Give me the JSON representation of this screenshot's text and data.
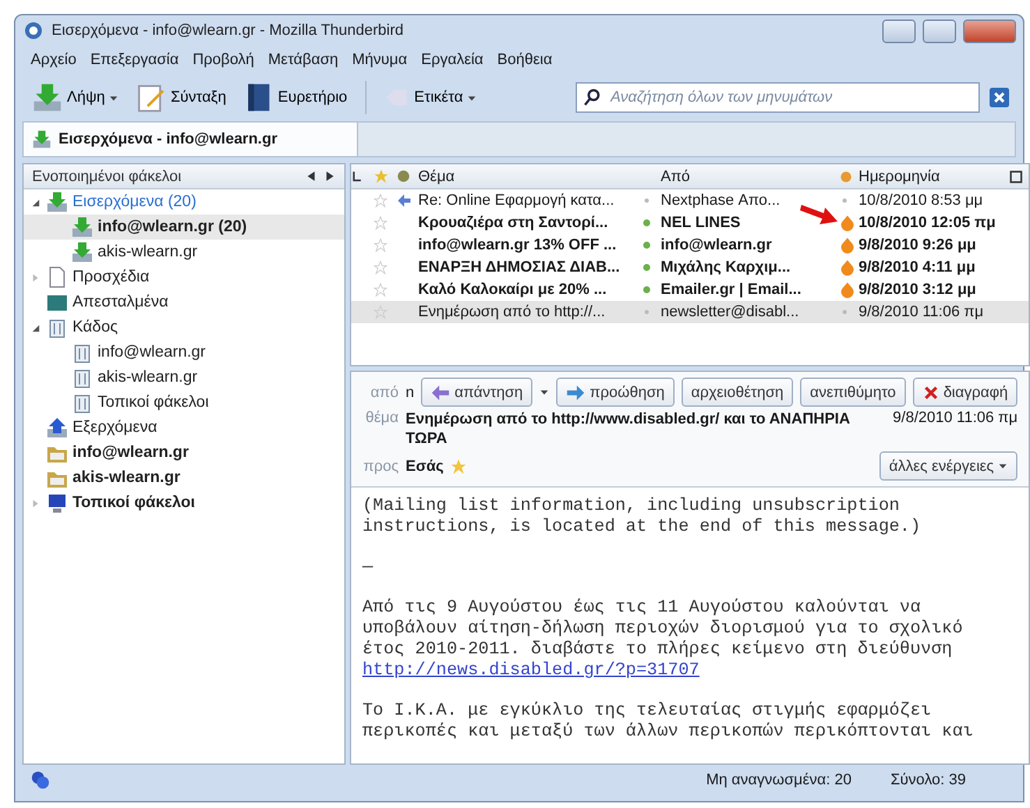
{
  "window": {
    "title": "Εισερχόμενα - info@wlearn.gr - Mozilla Thunderbird"
  },
  "menu": [
    "Αρχείο",
    "Επεξεργασία",
    "Προβολή",
    "Μετάβαση",
    "Μήνυμα",
    "Εργαλεία",
    "Βοήθεια"
  ],
  "toolbar": [
    {
      "label": "Λήψη",
      "kind": "get",
      "dropdown": true
    },
    {
      "label": "Σύνταξη",
      "kind": "write",
      "dropdown": false
    },
    {
      "label": "Ευρετήριο",
      "kind": "book",
      "dropdown": false
    },
    {
      "label": "Ετικέτα",
      "kind": "tag",
      "dropdown": true
    }
  ],
  "search": {
    "placeholder": "Αναζήτηση όλων των μηνυμάτων"
  },
  "tabs": [
    {
      "label": "Εισερχόμενα - info@wlearn.gr",
      "selected": true
    }
  ],
  "folder_pane": {
    "title": "Ενοποιημένοι φάκελοι",
    "folders": [
      {
        "label": "Εισερχόμενα (20)",
        "kind": "inbox",
        "bold": false,
        "new": true,
        "selected": false,
        "expanded": true,
        "children": [
          {
            "label": "info@wlearn.gr (20)",
            "kind": "inbox",
            "bold": true,
            "new": false,
            "selected": true
          },
          {
            "label": "akis-wlearn.gr",
            "kind": "inbox",
            "bold": false,
            "new": false,
            "selected": false
          }
        ]
      },
      {
        "label": "Προσχέδια",
        "kind": "drafts",
        "bold": false,
        "new": false,
        "selected": false,
        "expanded": false
      },
      {
        "label": "Απεσταλμένα",
        "kind": "sent",
        "bold": false,
        "new": false,
        "selected": false
      },
      {
        "label": "Κάδος",
        "kind": "trash",
        "bold": false,
        "new": false,
        "selected": false,
        "expanded": true,
        "children": [
          {
            "label": "info@wlearn.gr",
            "kind": "trash",
            "bold": false,
            "new": false,
            "selected": false
          },
          {
            "label": "akis-wlearn.gr",
            "kind": "trash",
            "bold": false,
            "new": false,
            "selected": false
          },
          {
            "label": "Τοπικοί φάκελοι",
            "kind": "trash",
            "bold": false,
            "new": false,
            "selected": false
          }
        ]
      },
      {
        "label": "Εξερχόμενα",
        "kind": "outbox",
        "bold": false,
        "new": false,
        "selected": false
      },
      {
        "label": "info@wlearn.gr",
        "kind": "account",
        "bold": true,
        "new": false,
        "selected": false
      },
      {
        "label": "akis-wlearn.gr",
        "kind": "account",
        "bold": true,
        "new": false,
        "selected": false
      },
      {
        "label": "Τοπικοί φάκελοι",
        "kind": "local",
        "bold": true,
        "new": false,
        "selected": false,
        "expanded": false
      }
    ]
  },
  "thread_pane": {
    "columns": [
      "Θέμα",
      "Από",
      "Ημερομηνία"
    ],
    "rows": [
      {
        "subject": "Re: Online Εφαρμογή κατα...",
        "from": "Nextphase Απο...",
        "date": "10/8/2010 8:53 μμ",
        "unread": false,
        "junk": false,
        "replied": true,
        "selected": false
      },
      {
        "subject": "Κρουαζιέρα στη Σαντορί...",
        "from": "NEL LINES",
        "date": "10/8/2010 12:05 πμ",
        "unread": true,
        "junk": true,
        "replied": false,
        "selected": false
      },
      {
        "subject": "info@wlearn.gr 13% OFF ...",
        "from": "info@wlearn.gr",
        "date": "9/8/2010 9:26 μμ",
        "unread": true,
        "junk": true,
        "replied": false,
        "selected": false
      },
      {
        "subject": "ΕΝΑΡΞΗ ΔΗΜΟΣΙΑΣ ΔΙΑΒ...",
        "from": "Μιχάλης Καρχιμ...",
        "date": "9/8/2010 4:11 μμ",
        "unread": true,
        "junk": true,
        "replied": false,
        "selected": false
      },
      {
        "subject": "Καλό Καλοκαίρι με 20% ...",
        "from": "Emailer.gr | Email...",
        "date": "9/8/2010 3:12 μμ",
        "unread": true,
        "junk": true,
        "replied": false,
        "selected": false
      },
      {
        "subject": "Ενημέρωση από το http://...",
        "from": "newsletter@disabl...",
        "date": "9/8/2010 11:06 πμ",
        "unread": false,
        "junk": false,
        "replied": false,
        "selected": true
      }
    ]
  },
  "message_header": {
    "from_label": "από",
    "from": "n",
    "buttons": [
      {
        "label": "απάντηση",
        "kind": "reply"
      },
      {
        "label": "προώθηση",
        "kind": "forward"
      },
      {
        "label": "αρχειοθέτηση",
        "kind": "plain"
      },
      {
        "label": "ανεπιθύμητο",
        "kind": "plain"
      },
      {
        "label": "διαγραφή",
        "kind": "delete"
      }
    ],
    "subject_label": "θέμα",
    "subject": "Ενημέρωση από το http://www.disabled.gr/ και το ΑΝΑΠΗΡΙΑ ΤΩΡΑ",
    "date": "9/8/2010 11:06 πμ",
    "to_label": "προς",
    "to": "Εσάς",
    "other_actions": "άλλες ενέργειες"
  },
  "message_body": [
    {
      "kind": "text",
      "text": "(Mailing list information, including unsubscription\ninstructions, is located at the end of this message.)"
    },
    {
      "kind": "text",
      "text": "—"
    },
    {
      "kind": "text",
      "text": "Από τις 9 Αυγούστου έως τις 11 Αυγούστου καλούνται να\nυποβάλουν αίτηση-δήλωση περιοχών διορισμού για το σχολικό\nέτος 2010-2011. διαβάστε το πλήρες κείμενο στη διεύθυνση"
    },
    {
      "kind": "link",
      "text": "http://news.disabled.gr/?p=31707"
    },
    {
      "kind": "text",
      "text": "Το Ι.Κ.Α. με εγκύκλιο της τελευταίας στιγμής εφαρμόζει\nπερικοπές και μεταξύ των άλλων περικοπών περικόπτονται και"
    }
  ],
  "status_bar": {
    "unread": "Μη αναγνωσμένα: 20",
    "total": "Σύνολο: 39"
  }
}
